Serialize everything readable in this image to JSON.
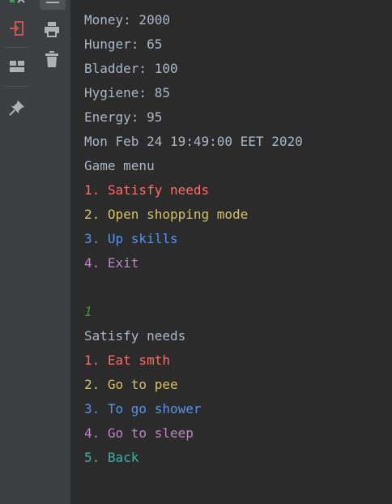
{
  "colors": {
    "stdout": "#a9b7c6",
    "red": "#ff6b68",
    "yellow": "#d4c265",
    "blue": "#5394ec",
    "purple": "#b887c2",
    "teal": "#3cb0a6",
    "user_input": "#3c9a2d"
  },
  "toolbar": {
    "icons": [
      "rerun-icon",
      "exit-icon",
      "layout-icon",
      "pin-icon",
      "soft-wrap-icon",
      "print-icon",
      "delete-icon"
    ]
  },
  "console": {
    "status": {
      "money": "Money: 2000",
      "hunger": "Hunger: 65",
      "bladder": "Bladder: 100",
      "hygiene": "Hygiene: 85",
      "energy": "Energy: 95",
      "date": "Mon Feb 24 19:49:00 EET 2020"
    },
    "game_menu": {
      "title": "Game menu",
      "items": [
        "1. Satisfy needs",
        "2. Open shopping mode",
        "3. Up skills",
        "4. Exit"
      ]
    },
    "user_input": "1",
    "needs_menu": {
      "title": "Satisfy needs",
      "items": [
        "1. Eat smth",
        "2. Go to pee",
        "3. To go shower",
        "4. Go to sleep",
        "5. Back"
      ]
    }
  }
}
